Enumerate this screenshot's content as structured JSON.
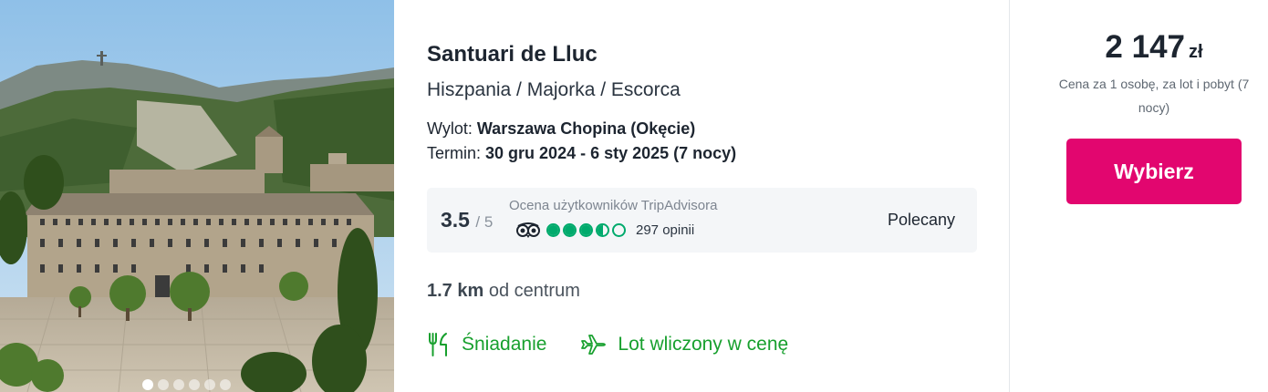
{
  "offer": {
    "image": {
      "slides_total": 6,
      "active_slide": 1
    },
    "hotel_name": "Santuari de Lluc",
    "location": "Hiszpania / Majorka / Escorca",
    "departure_label": "Wylot:",
    "departure_value": "Warszawa Chopina (Okęcie)",
    "term_label": "Termin:",
    "term_value": "30 gru 2024 - 6 sty 2025 (7 nocy)",
    "rating": {
      "score": "3.5",
      "score_max": "/ 5",
      "score_value": 3.5,
      "caption": "Ocena użytkowników TripAdvisora",
      "reviews": "297 opinii",
      "badge": "Polecany",
      "bubble_color": "#00aa6c"
    },
    "distance": {
      "value": "1.7 km",
      "label": "od centrum"
    },
    "features": [
      {
        "icon": "fork-knife-icon",
        "label": "Śniadanie"
      },
      {
        "icon": "airplane-icon",
        "label": "Lot wliczony w cenę"
      }
    ],
    "price": {
      "amount": "2 147",
      "currency": "zł",
      "note": "Cena za 1 osobę, za lot i pobyt (7 nocy)"
    },
    "cta_label": "Wybierz",
    "colors": {
      "accent": "#e2066f",
      "feature_green": "#18a02e"
    }
  }
}
